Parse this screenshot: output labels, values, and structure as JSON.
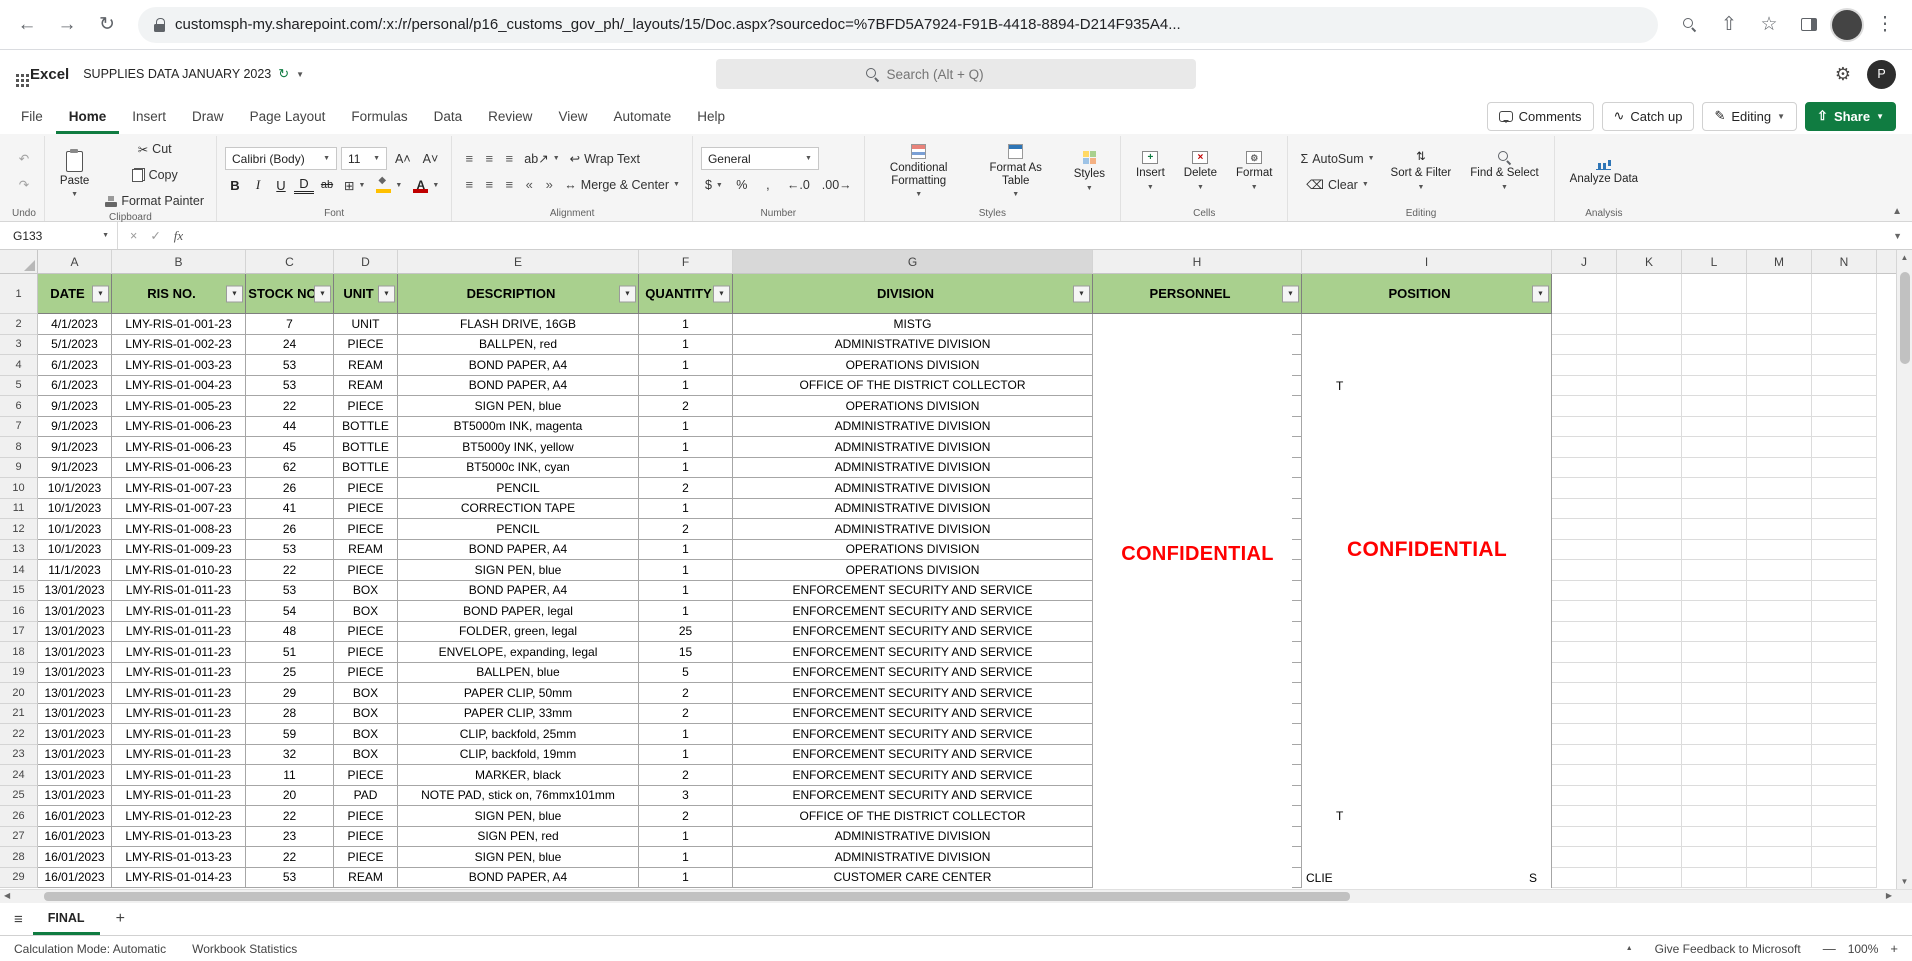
{
  "icons": {
    "filter": "▼"
  },
  "browser": {
    "url": "customsph-my.sharepoint.com/:x:/r/personal/p16_customs_gov_ph/_layouts/15/Doc.aspx?sourcedoc=%7BFD5A7924-F91B-4418-8894-D214F935A4..."
  },
  "app_header": {
    "app_name": "Excel",
    "doc_title": "SUPPLIES DATA JANUARY 2023",
    "search_placeholder": "Search (Alt + Q)",
    "avatar_initial": "P"
  },
  "menu": {
    "tabs": [
      "File",
      "Home",
      "Insert",
      "Draw",
      "Page Layout",
      "Formulas",
      "Data",
      "Review",
      "View",
      "Automate",
      "Help"
    ],
    "active_tab": "Home",
    "comments": "Comments",
    "catch_up": "Catch up",
    "editing": "Editing",
    "share": "Share"
  },
  "ribbon": {
    "paste": "Paste",
    "cut": "Cut",
    "copy": "Copy",
    "format_painter": "Format Painter",
    "font_name": "Calibri (Body)",
    "font_size": "11",
    "wrap_text": "Wrap Text",
    "merge_center": "Merge & Center",
    "number_format": "General",
    "conditional_formatting": "Conditional Formatting",
    "format_as_table": "Format As Table",
    "styles_btn": "Styles",
    "insert": "Insert",
    "delete": "Delete",
    "format": "Format",
    "autosum": "AutoSum",
    "clear": "Clear",
    "sort_filter": "Sort & Filter",
    "find_select": "Find & Select",
    "analyze_data": "Analyze Data",
    "groups": {
      "undo": "Undo",
      "clipboard": "Clipboard",
      "font": "Font",
      "alignment": "Alignment",
      "number": "Number",
      "styles": "Styles",
      "cells": "Cells",
      "editing": "Editing",
      "analysis": "Analysis"
    }
  },
  "formula_bar": {
    "name_box": "G133",
    "fx": "fx",
    "value": ""
  },
  "grid": {
    "col_letters": [
      "A",
      "B",
      "C",
      "D",
      "E",
      "F",
      "G",
      "H",
      "I",
      "J",
      "K",
      "L",
      "M",
      "N"
    ],
    "active_col_letter": "G",
    "first_data_row": 2,
    "header_row_number": "1",
    "header_cells": [
      "DATE",
      "RIS NO.",
      "STOCK NO",
      "UNIT",
      "DESCRIPTION",
      "QUANTITY",
      "DIVISION",
      "PERSONNEL",
      "POSITION"
    ],
    "watermark": "CONFIDENTIAL",
    "rows": [
      [
        "4/1/2023",
        "LMY-RIS-01-001-23",
        "7",
        "UNIT",
        "FLASH DRIVE, 16GB",
        "1",
        "MISTG",
        "",
        "",
        ""
      ],
      [
        "5/1/2023",
        "LMY-RIS-01-002-23",
        "24",
        "PIECE",
        "BALLPEN, red",
        "1",
        "ADMINISTRATIVE DIVISION",
        "",
        "",
        ""
      ],
      [
        "6/1/2023",
        "LMY-RIS-01-003-23",
        "53",
        "REAM",
        "BOND PAPER, A4",
        "1",
        "OPERATIONS DIVISION",
        "",
        "",
        ""
      ],
      [
        "6/1/2023",
        "LMY-RIS-01-004-23",
        "53",
        "REAM",
        "BOND PAPER, A4",
        "1",
        "OFFICE OF THE DISTRICT COLLECTOR",
        "",
        "T",
        ""
      ],
      [
        "9/1/2023",
        "LMY-RIS-01-005-23",
        "22",
        "PIECE",
        "SIGN PEN, blue",
        "2",
        "OPERATIONS DIVISION",
        "",
        "",
        ""
      ],
      [
        "9/1/2023",
        "LMY-RIS-01-006-23",
        "44",
        "BOTTLE",
        "BT5000m INK, magenta",
        "1",
        "ADMINISTRATIVE DIVISION",
        "",
        "",
        ""
      ],
      [
        "9/1/2023",
        "LMY-RIS-01-006-23",
        "45",
        "BOTTLE",
        "BT5000y INK, yellow",
        "1",
        "ADMINISTRATIVE DIVISION",
        "",
        "",
        ""
      ],
      [
        "9/1/2023",
        "LMY-RIS-01-006-23",
        "62",
        "BOTTLE",
        "BT5000c INK, cyan",
        "1",
        "ADMINISTRATIVE DIVISION",
        "",
        "",
        ""
      ],
      [
        "10/1/2023",
        "LMY-RIS-01-007-23",
        "26",
        "PIECE",
        "PENCIL",
        "2",
        "ADMINISTRATIVE DIVISION",
        "",
        "",
        ""
      ],
      [
        "10/1/2023",
        "LMY-RIS-01-007-23",
        "41",
        "PIECE",
        "CORRECTION TAPE",
        "1",
        "ADMINISTRATIVE DIVISION",
        "",
        "",
        ""
      ],
      [
        "10/1/2023",
        "LMY-RIS-01-008-23",
        "26",
        "PIECE",
        "PENCIL",
        "2",
        "ADMINISTRATIVE DIVISION",
        "",
        "",
        ""
      ],
      [
        "10/1/2023",
        "LMY-RIS-01-009-23",
        "53",
        "REAM",
        "BOND PAPER, A4",
        "1",
        "OPERATIONS DIVISION",
        "",
        "",
        ""
      ],
      [
        "11/1/2023",
        "LMY-RIS-01-010-23",
        "22",
        "PIECE",
        "SIGN PEN, blue",
        "1",
        "OPERATIONS DIVISION",
        "",
        "",
        ""
      ],
      [
        "13/01/2023",
        "LMY-RIS-01-011-23",
        "53",
        "BOX",
        "BOND PAPER, A4",
        "1",
        "ENFORCEMENT SECURITY AND SERVICE",
        "",
        "",
        ""
      ],
      [
        "13/01/2023",
        "LMY-RIS-01-011-23",
        "54",
        "BOX",
        "BOND PAPER, legal",
        "1",
        "ENFORCEMENT SECURITY AND SERVICE",
        "",
        "",
        ""
      ],
      [
        "13/01/2023",
        "LMY-RIS-01-011-23",
        "48",
        "PIECE",
        "FOLDER, green, legal",
        "25",
        "ENFORCEMENT SECURITY AND SERVICE",
        "",
        "",
        ""
      ],
      [
        "13/01/2023",
        "LMY-RIS-01-011-23",
        "51",
        "PIECE",
        "ENVELOPE, expanding, legal",
        "15",
        "ENFORCEMENT SECURITY AND SERVICE",
        "",
        "",
        ""
      ],
      [
        "13/01/2023",
        "LMY-RIS-01-011-23",
        "25",
        "PIECE",
        "BALLPEN, blue",
        "5",
        "ENFORCEMENT SECURITY AND SERVICE",
        "",
        "",
        ""
      ],
      [
        "13/01/2023",
        "LMY-RIS-01-011-23",
        "29",
        "BOX",
        "PAPER CLIP, 50mm",
        "2",
        "ENFORCEMENT SECURITY AND SERVICE",
        "",
        "",
        ""
      ],
      [
        "13/01/2023",
        "LMY-RIS-01-011-23",
        "28",
        "BOX",
        "PAPER CLIP, 33mm",
        "2",
        "ENFORCEMENT SECURITY AND SERVICE",
        "",
        "",
        ""
      ],
      [
        "13/01/2023",
        "LMY-RIS-01-011-23",
        "59",
        "BOX",
        "CLIP, backfold, 25mm",
        "1",
        "ENFORCEMENT SECURITY AND SERVICE",
        "",
        "",
        ""
      ],
      [
        "13/01/2023",
        "LMY-RIS-01-011-23",
        "32",
        "BOX",
        "CLIP, backfold, 19mm",
        "1",
        "ENFORCEMENT SECURITY AND SERVICE",
        "",
        "",
        ""
      ],
      [
        "13/01/2023",
        "LMY-RIS-01-011-23",
        "11",
        "PIECE",
        "MARKER, black",
        "2",
        "ENFORCEMENT SECURITY AND SERVICE",
        "",
        "",
        ""
      ],
      [
        "13/01/2023",
        "LMY-RIS-01-011-23",
        "20",
        "PAD",
        "NOTE PAD, stick on, 76mmx101mm",
        "3",
        "ENFORCEMENT SECURITY AND SERVICE",
        "",
        "",
        ""
      ],
      [
        "16/01/2023",
        "LMY-RIS-01-012-23",
        "22",
        "PIECE",
        "SIGN PEN, blue",
        "2",
        "OFFICE OF THE DISTRICT COLLECTOR",
        "",
        "T",
        ""
      ],
      [
        "16/01/2023",
        "LMY-RIS-01-013-23",
        "23",
        "PIECE",
        "SIGN PEN, red",
        "1",
        "ADMINISTRATIVE DIVISION",
        "",
        "",
        ""
      ],
      [
        "16/01/2023",
        "LMY-RIS-01-013-23",
        "22",
        "PIECE",
        "SIGN PEN, blue",
        "1",
        "ADMINISTRATIVE DIVISION",
        "",
        "",
        ""
      ],
      [
        "16/01/2023",
        "LMY-RIS-01-014-23",
        "53",
        "REAM",
        "BOND PAPER, A4",
        "1",
        "CUSTOMER CARE CENTER",
        "",
        "CLIE",
        "S"
      ]
    ]
  },
  "sheet_tabs": {
    "active": "FINAL",
    "add": "+"
  },
  "status_bar": {
    "calc_mode": "Calculation Mode: Automatic",
    "workbook_stats": "Workbook Statistics",
    "feedback": "Give Feedback to Microsoft",
    "zoom": "100%"
  }
}
